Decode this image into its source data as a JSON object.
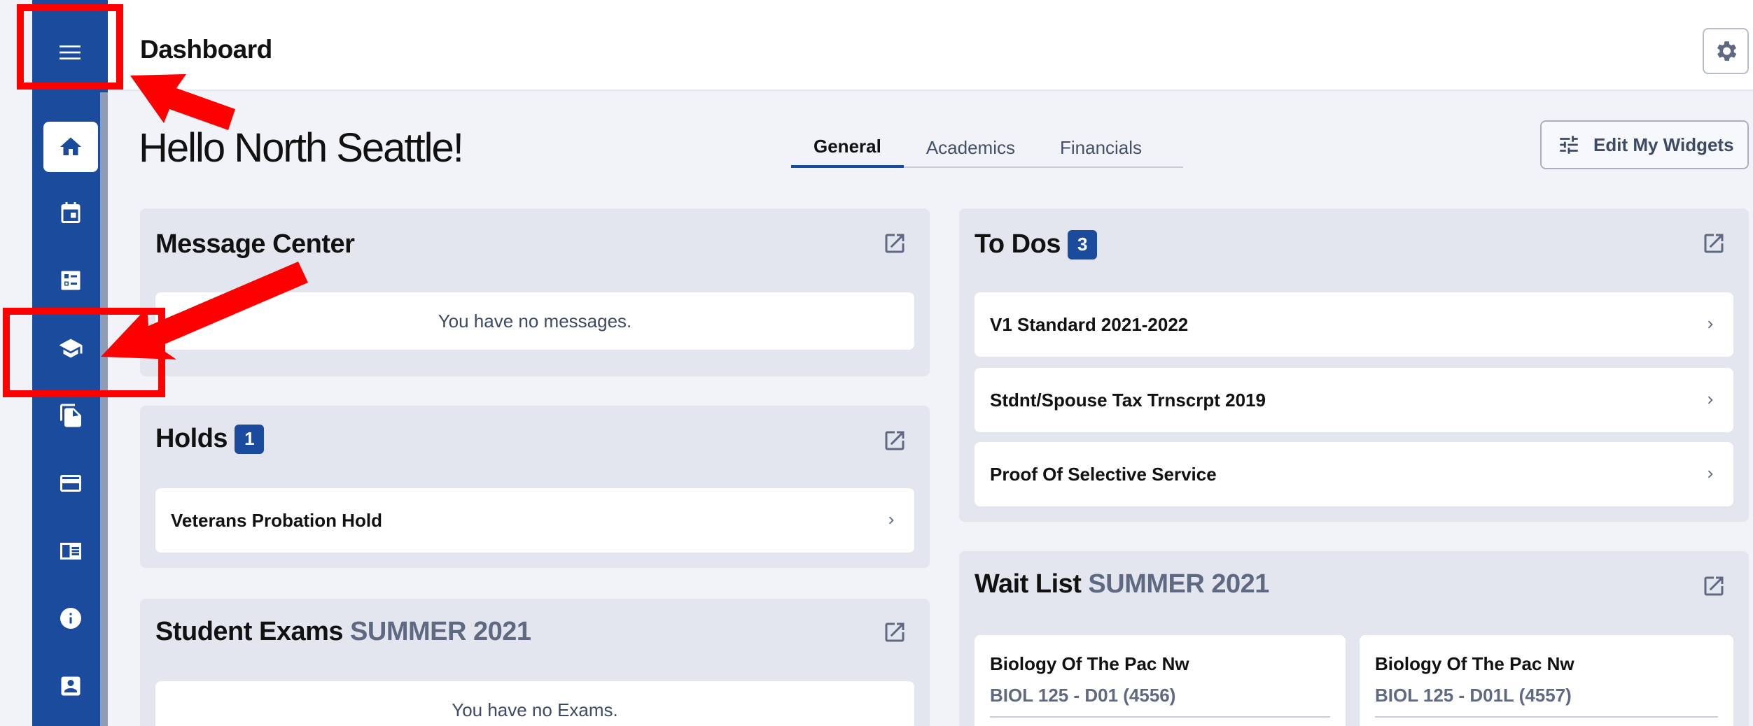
{
  "header": {
    "title": "Dashboard"
  },
  "greeting": "Hello North Seattle!",
  "tabs": [
    {
      "label": "General",
      "active": true
    },
    {
      "label": "Academics",
      "active": false
    },
    {
      "label": "Financials",
      "active": false
    }
  ],
  "edit_widgets_label": "Edit My Widgets",
  "sidebar": {
    "menu_icon": "menu-icon",
    "items": [
      {
        "icon": "home-icon",
        "active": true
      },
      {
        "icon": "calendar-icon",
        "active": false
      },
      {
        "icon": "checklist-icon",
        "active": false
      },
      {
        "icon": "graduation-cap-icon",
        "active": false
      },
      {
        "icon": "documents-icon",
        "active": false
      },
      {
        "icon": "credit-card-icon",
        "active": false
      },
      {
        "icon": "newspaper-icon",
        "active": false
      },
      {
        "icon": "info-icon",
        "active": false
      },
      {
        "icon": "contact-card-icon",
        "active": false
      }
    ]
  },
  "widgets": {
    "message_center": {
      "title": "Message Center",
      "empty": "You have no messages."
    },
    "holds": {
      "title": "Holds",
      "count": "1",
      "items": [
        "Veterans Probation Hold"
      ]
    },
    "student_exams": {
      "title": "Student Exams",
      "term": "SUMMER 2021",
      "empty": "You have no Exams."
    },
    "todos": {
      "title": "To Dos",
      "count": "3",
      "items": [
        "V1 Standard 2021-2022",
        "Stdnt/Spouse Tax Trnscrpt 2019",
        "Proof Of Selective Service"
      ]
    },
    "wait_list": {
      "title": "Wait List",
      "term": "SUMMER 2021",
      "items": [
        {
          "name": "Biology Of The Pac Nw",
          "code": "BIOL 125 - D01 (4556)"
        },
        {
          "name": "Biology Of The Pac Nw",
          "code": "BIOL 125 - D01L (4557)"
        }
      ]
    }
  },
  "colors": {
    "sidebar": "#1a4b9c",
    "accent": "#1a4b9c",
    "annotation": "#ff0000",
    "background": "#f1f3f8"
  }
}
